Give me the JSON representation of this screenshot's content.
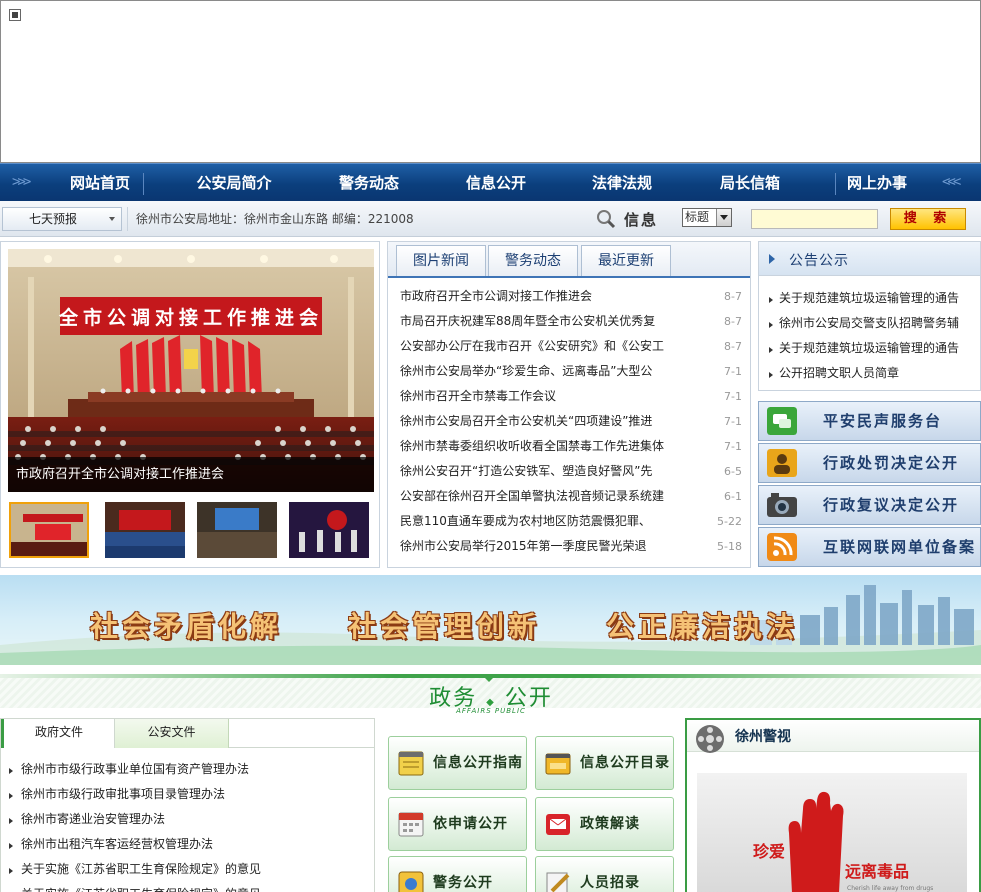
{
  "nav": {
    "items": [
      "网站首页",
      "公安局简介",
      "警务动态",
      "信息公开",
      "法律法规",
      "局长信箱",
      "网上办事"
    ]
  },
  "infobar": {
    "forecast": "七天预报",
    "address": "徐州市公安局地址：徐州市金山东路  邮编：221008",
    "search_label": "信息",
    "search_option": "标题",
    "search_value": "",
    "search_button": "搜 索"
  },
  "photo": {
    "caption": "市政府召开全市公调对接工作推进会",
    "banner_text": "全市公调对接工作推进会"
  },
  "news": {
    "tabs": [
      "图片新闻",
      "警务动态",
      "最近更新"
    ],
    "rows": [
      {
        "title": "市政府召开全市公调对接工作推进会",
        "date": "8-7"
      },
      {
        "title": "市局召开庆祝建军88周年暨全市公安机关优秀复",
        "date": "8-7"
      },
      {
        "title": "公安部办公厅在我市召开《公安研究》和《公安工",
        "date": "8-7"
      },
      {
        "title": "徐州市公安局举办“珍爱生命、远离毒品”大型公",
        "date": "7-1"
      },
      {
        "title": "徐州市召开全市禁毒工作会议",
        "date": "7-1"
      },
      {
        "title": "徐州市公安局召开全市公安机关“四项建设”推进",
        "date": "7-1"
      },
      {
        "title": "徐州市禁毒委组织收听收看全国禁毒工作先进集体",
        "date": "7-1"
      },
      {
        "title": "徐州公安召开“打造公安铁军、塑造良好警风”先",
        "date": "6-5"
      },
      {
        "title": "公安部在徐州召开全国单警执法视音频记录系统建",
        "date": "6-1"
      },
      {
        "title": "民意110直通车要成为农村地区防范震慑犯罪、",
        "date": "5-22"
      },
      {
        "title": "徐州市公安局举行2015年第一季度民警光荣退",
        "date": "5-18"
      }
    ]
  },
  "notice": {
    "title": "公告公示",
    "items": [
      "关于规范建筑垃圾运输管理的通告",
      "徐州市公安局交警支队招聘警务辅",
      "关于规范建筑垃圾运输管理的通告",
      "公开招聘文职人员简章"
    ]
  },
  "services": [
    "平安民声服务台",
    "行政处罚决定公开",
    "行政复议决定公开",
    "互联网联网单位备案"
  ],
  "slogans": [
    "社会矛盾化解",
    "社会管理创新",
    "公正廉洁执法"
  ],
  "affairs": {
    "title": "政务",
    "title2": "公开",
    "subtitle": "AFFAIRS PUBLIC"
  },
  "docs": {
    "tabs": [
      "政府文件",
      "公安文件"
    ],
    "items": [
      "徐州市市级行政事业单位国有资产管理办法",
      "徐州市市级行政审批事项目录管理办法",
      "徐州市寄递业治安管理办法",
      "徐州市出租汽车客运经营权管理办法",
      "关于实施《江苏省职工生育保险规定》的意见",
      "关于实施《江苏省职工生育保险规定》的意见"
    ]
  },
  "affair_buttons": [
    "信息公开指南",
    "信息公开目录",
    "依申请公开",
    "政策解读",
    "警务公开",
    "人员招录"
  ],
  "video": {
    "title": "徐州警视",
    "thumb_text1": "珍爱",
    "thumb_text2": "远离毒品",
    "thumb_text3": "Cherish life away from drugs"
  },
  "colors": {
    "nav": "#0b3f7d",
    "accent_green": "#3a9c44",
    "banner_red": "#c4181c"
  }
}
